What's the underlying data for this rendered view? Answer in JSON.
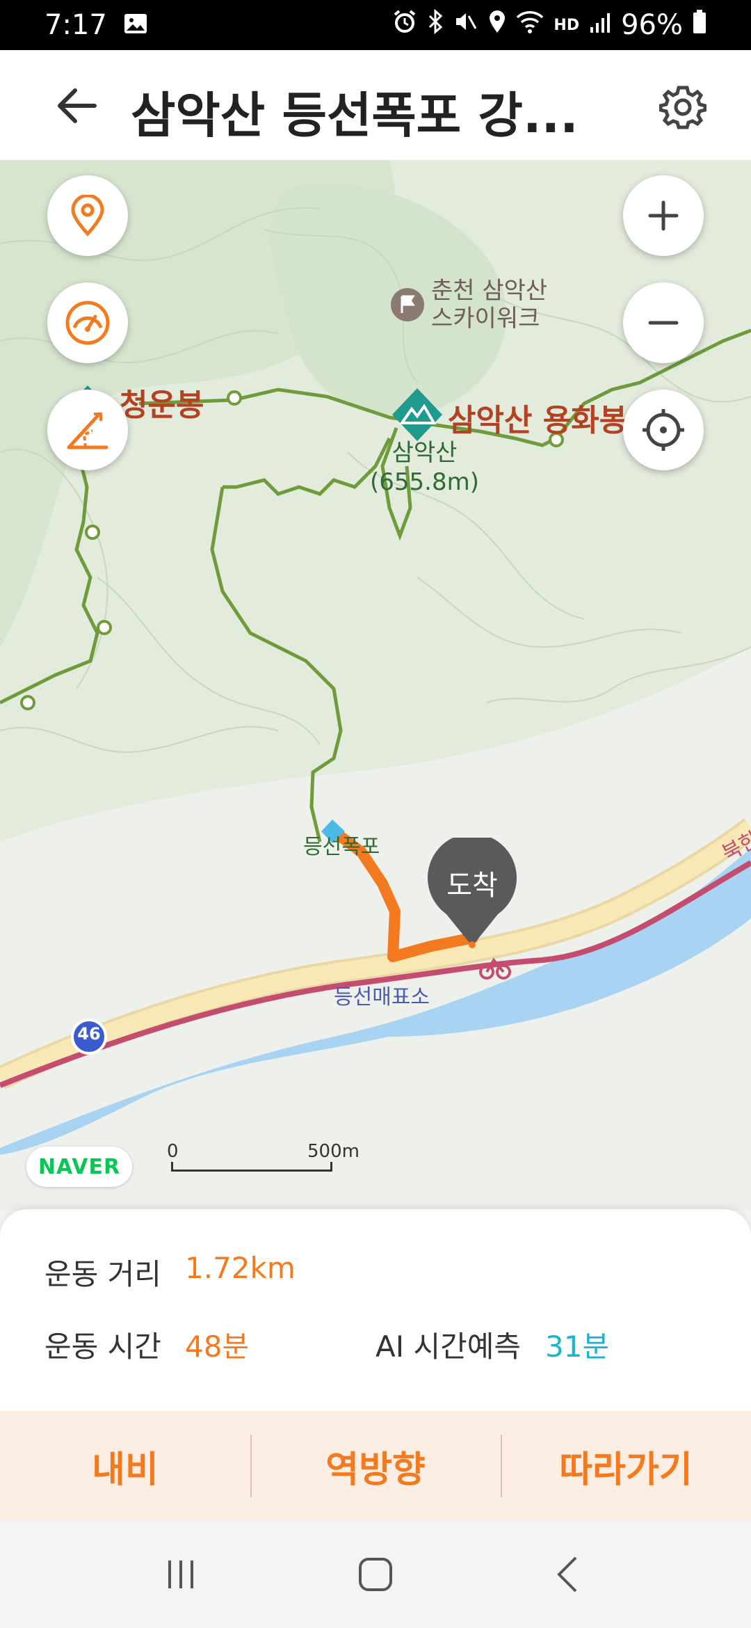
{
  "status_bar": {
    "time": "7:17",
    "battery": "96%",
    "hd_label": "HD"
  },
  "header": {
    "title": "삼악산 등선폭포 강..."
  },
  "map": {
    "labels": {
      "skywalk_line1": "춘천 삼악산",
      "skywalk_line2": "스카이워크",
      "cheongunbong": "청운봉",
      "yonghwabong": "삼악산 용화봉",
      "samaksan_name": "삼악산",
      "samaksan_height": "(655.8m)",
      "deungseon_falls": "등선폭포",
      "ticket_office": "등선매표소",
      "arrival_marker": "도착",
      "road_number": "46",
      "river_label": "북한"
    },
    "naver_logo": "NAVER",
    "scale": {
      "zero": "0",
      "distance": "500m"
    }
  },
  "stats": {
    "distance_label": "운동 거리",
    "distance_value": "1.72km",
    "time_label": "운동 시간",
    "time_value": "48분",
    "ai_label": "AI 시간예측",
    "ai_value": "31분"
  },
  "actions": {
    "navi": "내비",
    "reverse": "역방향",
    "follow": "따라가기"
  },
  "colors": {
    "accent": "#f47a1f",
    "ai_accent": "#19b5cf",
    "trail": "#6f9b3a",
    "river": "#a8d3f2",
    "road": "#f6e0a8"
  }
}
